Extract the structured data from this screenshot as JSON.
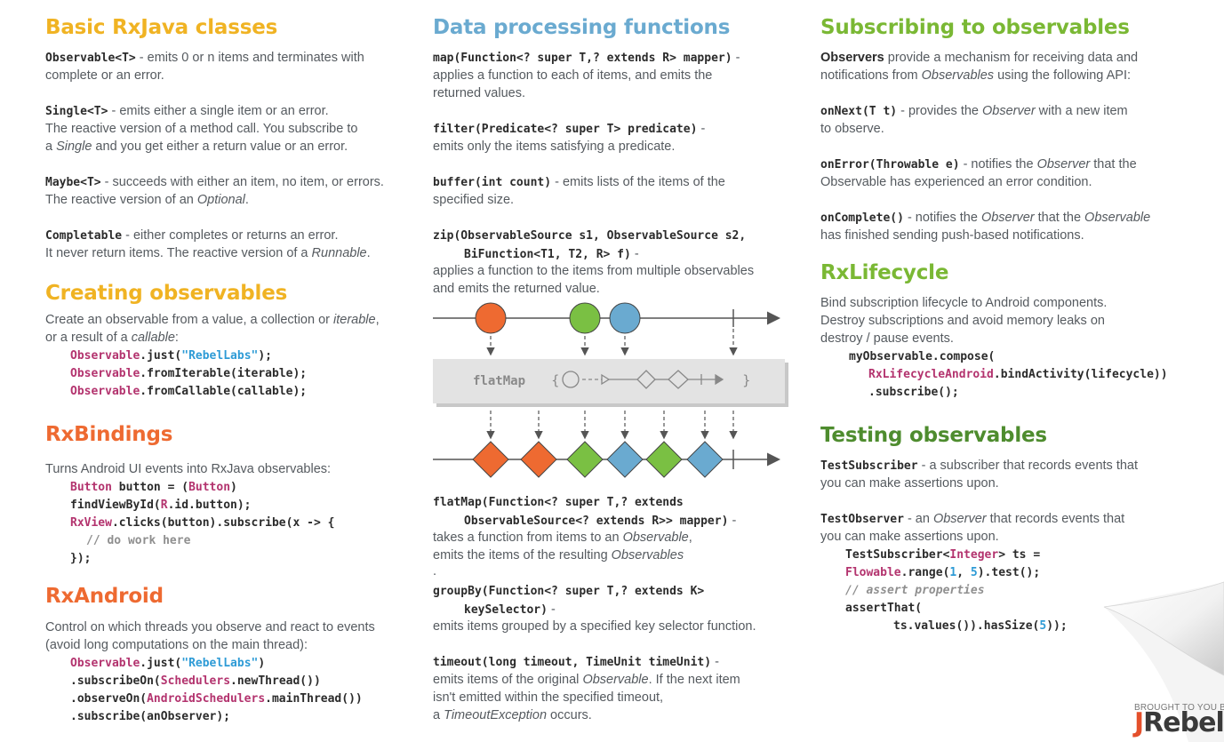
{
  "col1": {
    "basic": {
      "title": "Basic RxJava classes",
      "observable": {
        "code": "Observable<T>",
        "l1": " - emits 0 or n items and terminates with",
        "l2": "complete or an error."
      },
      "single": {
        "code": "Single<T>",
        "l1": " - emits either a single item or an error.",
        "l2": "The reactive version of a method call. You subscribe to",
        "l3a": "a ",
        "l3b": "Single",
        "l3c": " and you get either a return value or an error."
      },
      "maybe": {
        "code": "Maybe<T>",
        "l1": " - succeeds with either an item, no item, or errors.",
        "l2a": "The reactive version of an ",
        "l2b": "Optional",
        "l2c": "."
      },
      "completable": {
        "code": "Completable",
        "l1": " - either completes or returns an error.",
        "l2a": "It never return items. The reactive version of a ",
        "l2b": "Runnable",
        "l2c": "."
      }
    },
    "creating": {
      "title": "Creating observables",
      "l1a": "Create an observable from a value, a collection or ",
      "l1b": "iterable",
      "l1c": ",",
      "l2a": "or a result of a ",
      "l2b": "callable",
      "l2c": ":",
      "code1a": "Observable",
      "code1b": ".just(",
      "code1c": "\"RebelLabs\"",
      "code1d": ");",
      "code2a": "Observable",
      "code2b": ".fromIterable(iterable);",
      "code3a": "Observable",
      "code3b": ".fromCallable(callable);"
    },
    "bindings": {
      "title": "RxBindings",
      "l1": "Turns Android UI events into RxJava observables:",
      "c1a": "Button",
      "c1b": " button = (",
      "c1c": "Button",
      "c1d": ")",
      "c2a": "findViewById(",
      "c2b": "R",
      "c2c": ".id.button);",
      "c3a": "RxView",
      "c3b": ".clicks(button).subscribe(x -> {",
      "c4": "// do work here",
      "c5": "});"
    },
    "android": {
      "title": "RxAndroid",
      "l1": "Control on which threads you observe and react to events",
      "l2": "(avoid long computations on the main thread):",
      "c1a": "Observable",
      "c1b": ".just(",
      "c1c": "\"RebelLabs\"",
      "c1d": ")",
      "c2a": ".subscribeOn(",
      "c2b": "Schedulers",
      "c2c": ".newThread())",
      "c3a": ".observeOn(",
      "c3b": "AndroidSchedulers",
      "c3c": ".mainThread())",
      "c4": ".subscribe(anObserver);"
    }
  },
  "col2": {
    "title": "Data processing functions",
    "map": {
      "code": "map(Function<? super T,? extends R> mapper)",
      "dash": " -",
      "l1": "applies a function to each of items, and emits the",
      "l2": "returned values."
    },
    "filter": {
      "code": "filter(Predicate<? super T> predicate)",
      "dash": " -",
      "l1": "emits only the items satisfying a predicate."
    },
    "buffer": {
      "code": "buffer(int count)",
      "l1": " - emits lists of the items of the",
      "l2": "specified size."
    },
    "zip": {
      "code1": "zip(ObservableSource s1, ObservableSource s2,",
      "code2": "BiFunction<T1, T2, R> f)",
      "dash": " -",
      "l1": "applies a function to the items from multiple observables",
      "l2": "and emits the returned value."
    },
    "diagram": {
      "label": "flatMap"
    },
    "flatmap": {
      "code1": "flatMap(Function<? super T,? extends",
      "code2": "ObservableSource<? extends R>> mapper)",
      "dash": " -",
      "l1a": "takes a function from items to an ",
      "l1b": "Observable",
      "l1c": ",",
      "l2a": "emits the items of the resulting ",
      "l2b": "Observables",
      "l3": "."
    },
    "groupby": {
      "code1": "groupBy(Function<? super T,? extends K>",
      "code2": "keySelector)",
      "dash": " -",
      "l1": "emits items grouped by a specified key selector function."
    },
    "timeout": {
      "code": "timeout(long timeout, TimeUnit timeUnit)",
      "dash": " -",
      "l1a": "emits items of the original ",
      "l1b": "Observable",
      "l1c": ". If the next item",
      "l2": "isn't emitted within the specified timeout,",
      "l3a": "a ",
      "l3b": "TimeoutException",
      "l3c": " occurs."
    }
  },
  "col3": {
    "subscribing": {
      "title": "Subscribing to observables",
      "l1a": "Observers",
      "l1b": " provide a mechanism for receiving data and",
      "l2a": "notifications from ",
      "l2b": "Observables",
      "l2c": " using the following API:",
      "onnext": {
        "code": "onNext(T t)",
        "l1a": " - provides the ",
        "l1b": "Observer",
        "l1c": " with a new item",
        "l2": "to observe."
      },
      "onerror": {
        "code": "onError(Throwable e)",
        "l1a": " - notifies the ",
        "l1b": "Observer",
        "l1c": " that the",
        "l2": "Observable has experienced an error condition."
      },
      "oncomplete": {
        "code": "onComplete()",
        "l1a": " - notifies the ",
        "l1b": "Observer",
        "l1c": " that the ",
        "l1d": "Observable",
        "l2": "has finished sending push-based notifications."
      }
    },
    "lifecycle": {
      "title": "RxLifecycle",
      "l1": "Bind subscription lifecycle to Android components.",
      "l2": "Destroy subscriptions and avoid memory leaks on",
      "l3": "destroy / pause events.",
      "c1": "myObservable.compose(",
      "c2a": "RxLifecycleAndroid",
      "c2b": ".bindActivity(lifecycle))",
      "c3": ".subscribe();"
    },
    "testing": {
      "title": "Testing observables",
      "ts": {
        "code": "TestSubscriber",
        "l1": " - a subscriber that records events that",
        "l2": "you can make assertions upon."
      },
      "to": {
        "code": "TestObserver",
        "l1a": " - an ",
        "l1b": "Observer",
        "l1c": " that records events that",
        "l2": "you can make assertions upon."
      },
      "c1a": "TestSubscriber<",
      "c1b": "Integer",
      "c1c": "> ts =",
      "c2a": "Flowable",
      "c2b": ".range(",
      "c2c": "1",
      "c2d": ", ",
      "c2e": "5",
      "c2f": ").test();",
      "c3": "// assert properties",
      "c4": "assertThat(",
      "c5a": "ts.values()).hasSize(",
      "c5b": "5",
      "c5c": "));"
    }
  },
  "footer": {
    "brought": "BROUGHT TO YOU BY",
    "logo_j": "J",
    "logo_rest": "Rebel"
  },
  "colors": {
    "yellow": "#f0b323",
    "blue": "#6aaad0",
    "green": "#7ab834",
    "orange": "#ee6a31",
    "dark_green": "#4e8c2e",
    "keyword": "#b3336e",
    "string": "#2e9bd6"
  }
}
